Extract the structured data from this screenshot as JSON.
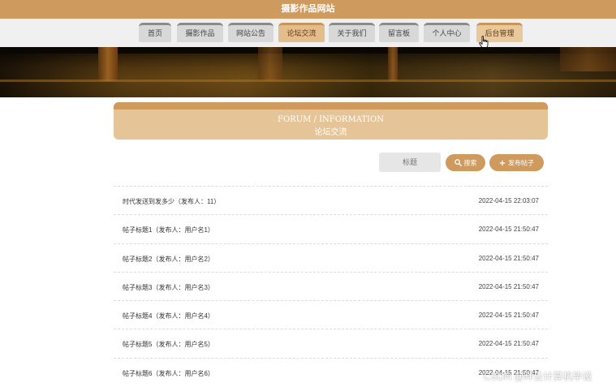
{
  "site": {
    "title": "摄影作品网站"
  },
  "nav": {
    "items": [
      {
        "label": "首页",
        "state": "normal"
      },
      {
        "label": "摄影作品",
        "state": "normal"
      },
      {
        "label": "网站公告",
        "state": "normal"
      },
      {
        "label": "论坛交流",
        "state": "active"
      },
      {
        "label": "关于我们",
        "state": "normal"
      },
      {
        "label": "留言板",
        "state": "normal"
      },
      {
        "label": "个人中心",
        "state": "normal"
      },
      {
        "label": "后台管理",
        "state": "hover"
      }
    ]
  },
  "section": {
    "title_en": "FORUM / INFORMATION",
    "title_cn": "论坛交流"
  },
  "search": {
    "placeholder": "标题",
    "search_label": "搜索",
    "post_label": "发布帖子",
    "search_icon": "search-icon",
    "post_icon": "plus-icon"
  },
  "posts": [
    {
      "title": "时代发送到发多少（发布人：11）",
      "date": "2022-04-15 22:03:07"
    },
    {
      "title": "帖子标题1（发布人：用户名1）",
      "date": "2022-04-15 21:50:47"
    },
    {
      "title": "帖子标题2（发布人：用户名2）",
      "date": "2022-04-15 21:50:47"
    },
    {
      "title": "帖子标题3（发布人：用户名3）",
      "date": "2022-04-15 21:50:47"
    },
    {
      "title": "帖子标题4（发布人：用户名4）",
      "date": "2022-04-15 21:50:47"
    },
    {
      "title": "帖子标题5（发布人：用户名5）",
      "date": "2022-04-15 21:50:47"
    },
    {
      "title": "帖子标题6（发布人：用户名6）",
      "date": "2022-04-15 21:50:47"
    }
  ],
  "watermark": "CSDN @畔云计算机毕设",
  "colors": {
    "brand": "#cf9a5e",
    "header_light": "#e5c598",
    "nav_bg": "#f0f0f0"
  }
}
